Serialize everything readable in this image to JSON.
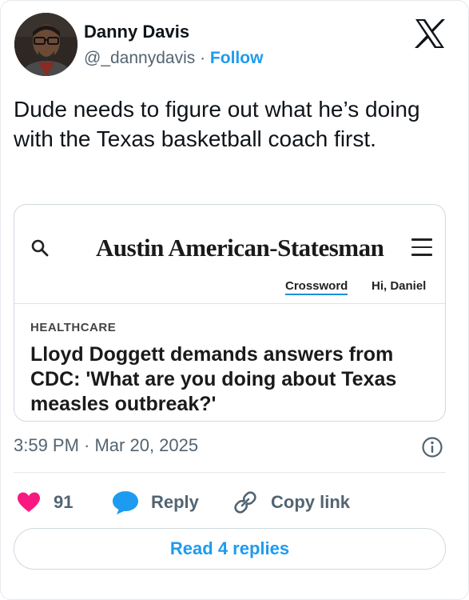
{
  "author": {
    "name": "Danny Davis",
    "handle": "@_dannydavis",
    "separator": " · ",
    "follow_label": "Follow"
  },
  "brand_icon": "x-logo-icon",
  "tweet": {
    "text": "Dude needs to figure out what he’s doing with the Texas basketball coach first."
  },
  "card": {
    "masthead": "Austin American-Statesman",
    "search_icon": "search-icon",
    "menu_icon": "hamburger-menu-icon",
    "crossword_label": "Crossword",
    "greeting": "Hi, Daniel",
    "section": "HEALTHCARE",
    "headline": "Lloyd Doggett demands answers from CDC: 'What are you doing about Texas measles outbreak?'"
  },
  "meta": {
    "timestamp": "3:59 PM · Mar 20, 2025",
    "info_icon": "info-icon"
  },
  "actions": {
    "like_count": "91",
    "like_icon": "heart-icon",
    "reply_label": "Reply",
    "reply_icon": "speech-bubble-icon",
    "copy_label": "Copy link",
    "copy_icon": "link-icon"
  },
  "read_replies_label": "Read 4 replies",
  "colors": {
    "accent": "#1d9bf0",
    "like": "#f91880",
    "text": "#0f1419",
    "secondary": "#536471",
    "border": "#cfd9de"
  }
}
